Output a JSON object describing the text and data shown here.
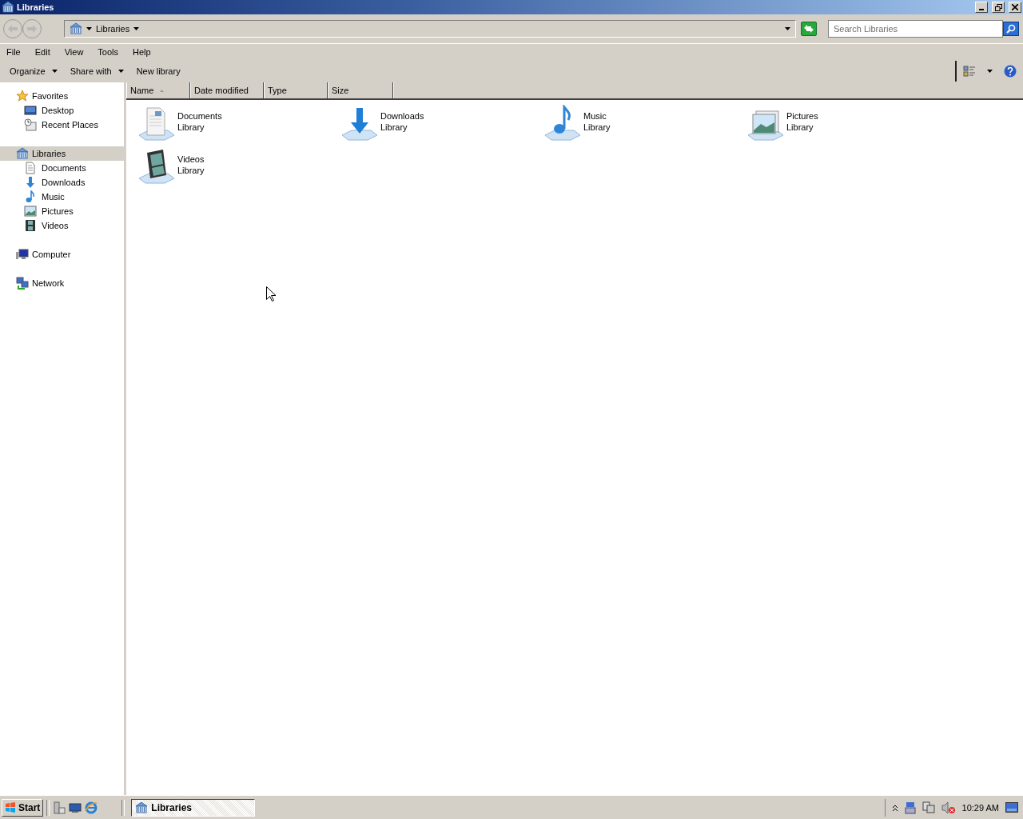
{
  "window": {
    "title": "Libraries"
  },
  "address": {
    "crumbs": [
      "Libraries"
    ]
  },
  "search": {
    "placeholder": "Search Libraries"
  },
  "menu": [
    "File",
    "Edit",
    "View",
    "Tools",
    "Help"
  ],
  "toolbar": [
    {
      "label": "Organize",
      "dropdown": true
    },
    {
      "label": "Share with",
      "dropdown": true
    },
    {
      "label": "New library",
      "dropdown": false
    }
  ],
  "sidebar": {
    "groups": [
      {
        "label": "Favorites",
        "selected": false,
        "children": [
          {
            "label": "Desktop",
            "selected": false
          },
          {
            "label": "Recent Places",
            "selected": false
          }
        ]
      },
      {
        "label": "Libraries",
        "selected": true,
        "children": [
          {
            "label": "Documents",
            "selected": false
          },
          {
            "label": "Downloads",
            "selected": false
          },
          {
            "label": "Music",
            "selected": false
          },
          {
            "label": "Pictures",
            "selected": false
          },
          {
            "label": "Videos",
            "selected": false
          }
        ]
      },
      {
        "label": "Computer",
        "selected": false
      },
      {
        "label": "Network",
        "selected": false
      }
    ]
  },
  "columns": [
    {
      "label": "Name",
      "sorted": true
    },
    {
      "label": "Date modified",
      "sorted": false
    },
    {
      "label": "Type",
      "sorted": false
    },
    {
      "label": "Size",
      "sorted": false
    }
  ],
  "items": [
    {
      "name": "Documents",
      "type": "Library"
    },
    {
      "name": "Downloads",
      "type": "Library"
    },
    {
      "name": "Music",
      "type": "Library"
    },
    {
      "name": "Pictures",
      "type": "Library"
    },
    {
      "name": "Videos",
      "type": "Library"
    }
  ],
  "taskbar": {
    "start": "Start",
    "tasks": [
      {
        "label": "Libraries",
        "selected": true
      }
    ],
    "clock": "10:29 AM"
  }
}
